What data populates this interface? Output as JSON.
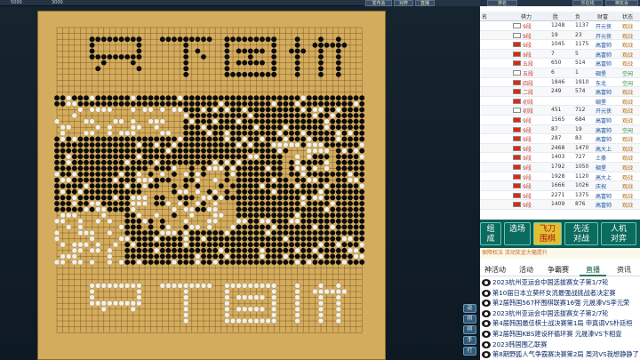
{
  "topbar": {
    "left_items": [
      "5000",
      "3000"
    ],
    "right_items": [
      "发布会",
      "对弈",
      "直播",
      "排名",
      "乐在线",
      "棋友会"
    ]
  },
  "board": {
    "title_top": "只下围棋",
    "title_bottom": "只下围棋",
    "stone_black": "#0b0b0b",
    "stone_white": "#f4f0e6",
    "board_color": "#d4ac5e"
  },
  "side_tools": [
    "返",
    "棋",
    "棋",
    "手",
    "打"
  ],
  "right_tabs": [
    "发布会",
    "对弈",
    "直播",
    "排名",
    "乐在线",
    "棋友会"
  ],
  "table": {
    "headers": [
      "名",
      "棋力",
      "胜",
      "负",
      "财富",
      "状态"
    ],
    "rows": [
      {
        "rank": "9段",
        "win": "1248",
        "lose": "1137",
        "wealth": "开元侠",
        "status": "观战",
        "flag": "jp"
      },
      {
        "rank": "9段",
        "win": "19",
        "lose": "23",
        "wealth": "开元侠",
        "status": "观战",
        "flag": "jp"
      },
      {
        "rank": "9段",
        "win": "1045",
        "lose": "1175",
        "wealth": "高富帅",
        "status": "观战",
        "flag": "cn"
      },
      {
        "rank": "9段",
        "win": "7",
        "lose": "5",
        "wealth": "高富帅",
        "status": "观战",
        "flag": "cn"
      },
      {
        "rank": "五段",
        "win": "650",
        "lose": "514",
        "wealth": "高富帅",
        "status": "观战",
        "flag": "cn"
      },
      {
        "rank": "五段",
        "win": "6",
        "lose": "1",
        "wealth": "碉堡",
        "status": "空闲",
        "flag": "jp"
      },
      {
        "rank": "四段",
        "win": "1846",
        "lose": "1910",
        "wealth": "东北",
        "status": "空闲",
        "flag": "cn"
      },
      {
        "rank": "二段",
        "win": "249",
        "lose": "574",
        "wealth": "高富帅",
        "status": "观战",
        "flag": "cn"
      },
      {
        "rank": "初段",
        "win": "",
        "lose": "",
        "wealth": "碉堡",
        "status": "观战",
        "flag": "cn"
      },
      {
        "rank": "初段",
        "win": "451",
        "lose": "712",
        "wealth": "开元侠",
        "status": "观战",
        "flag": "kr"
      },
      {
        "rank": "9段",
        "win": "1565",
        "lose": "684",
        "wealth": "高富帅",
        "status": "观战",
        "flag": "cn"
      },
      {
        "rank": "9段",
        "win": "87",
        "lose": "19",
        "wealth": "高富帅",
        "status": "空闲",
        "flag": "cn"
      },
      {
        "rank": "9段",
        "win": "287",
        "lose": "83",
        "wealth": "高富帅",
        "status": "观战",
        "flag": "cn"
      },
      {
        "rank": "9段",
        "win": "2468",
        "lose": "1470",
        "wealth": "高大上",
        "status": "观战",
        "flag": "cn"
      },
      {
        "rank": "9段",
        "win": "1403",
        "lose": "727",
        "wealth": "土豪",
        "status": "观战",
        "flag": "cn"
      },
      {
        "rank": "9段",
        "win": "1792",
        "lose": "1050",
        "wealth": "碉堡",
        "status": "观战",
        "flag": "cn"
      },
      {
        "rank": "9段",
        "win": "1928",
        "lose": "1120",
        "wealth": "高大上",
        "status": "观战",
        "flag": "cn"
      },
      {
        "rank": "9段",
        "win": "1666",
        "lose": "1026",
        "wealth": "庆祝",
        "status": "观战",
        "flag": "cn"
      },
      {
        "rank": "9段",
        "win": "2271",
        "lose": "1375",
        "wealth": "高富帅",
        "status": "观战",
        "flag": "cn"
      },
      {
        "rank": "9段",
        "win": "1409",
        "lose": "876",
        "wealth": "高富帅",
        "status": "观战",
        "flag": "cn"
      }
    ]
  },
  "mode_buttons": [
    {
      "label": "组\n成",
      "bg": "#0b6b5e"
    },
    {
      "label": "选场",
      "bg": "#0b6b5e"
    },
    {
      "label": "飞刀\n围棋",
      "bg": "#e0c032"
    },
    {
      "label": "先活\n对战",
      "bg": "#0b6b5e"
    },
    {
      "label": "人机\n对弈",
      "bg": "#0b6b5e"
    }
  ],
  "ticker": "保障权法  流动奖金大幅提升",
  "news_tabs": [
    "神活动",
    "活动",
    "争霸赛",
    "直播",
    "资讯"
  ],
  "news_active": 3,
  "news": [
    "2023杭州亚运会中国选拔赛女子第1/7轮",
    "第10届日本立葵杯女流最强战挑战者决定赛",
    "第2届韩国567杯围棋联赛16强 元晟溱VS李元荣",
    "2023杭州亚运会中国选拔赛女子第2/7轮",
    "第4届韩国最佳棋士战决赛第1局 申真谞VS朴廷桓",
    "第2届韩国KBS建设杯循环赛 元晟溱VS卞相壹",
    "2023韩国围乙联赛",
    "第8期野狐人气争霸赛决赛第2局 周鸿VS我想静静了"
  ]
}
